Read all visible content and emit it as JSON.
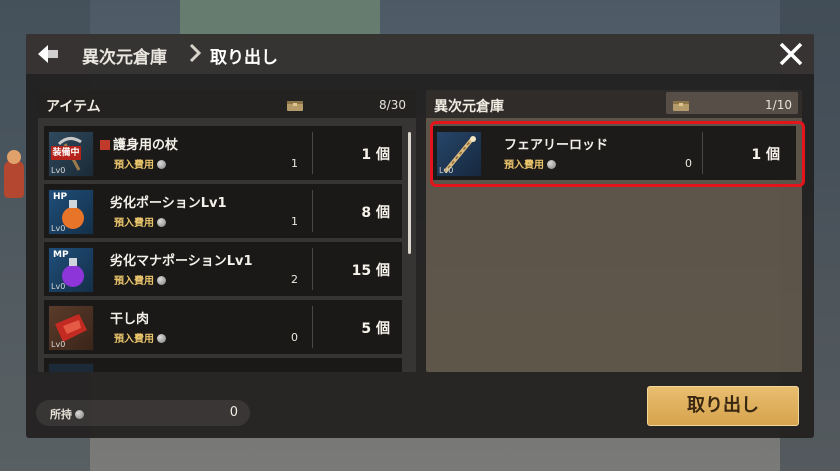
{
  "header": {
    "breadcrumb_root": "異次元倉庫",
    "breadcrumb_current": "取り出し"
  },
  "inventory": {
    "title": "アイテム",
    "count": "8/30",
    "scrollbar_visible": true,
    "items": [
      {
        "name": "護身用の杖",
        "fee_label": "預入費用",
        "fee": "1",
        "qty": "1 個",
        "equipped_badge": "装備中",
        "level": "Lv0",
        "icon": "staff-icon"
      },
      {
        "name": "劣化ポーションLv1",
        "fee_label": "預入費用",
        "fee": "1",
        "qty": "8 個",
        "level": "Lv0",
        "badge": "HP",
        "icon": "hp-potion-icon"
      },
      {
        "name": "劣化マナポーションLv1",
        "fee_label": "預入費用",
        "fee": "2",
        "qty": "15 個",
        "level": "Lv0",
        "badge": "MP",
        "icon": "mp-potion-icon"
      },
      {
        "name": "干し肉",
        "fee_label": "預入費用",
        "fee": "0",
        "qty": "5 個",
        "level": "Lv0",
        "icon": "dried-meat-icon"
      }
    ]
  },
  "storage": {
    "title": "異次元倉庫",
    "count": "1/10",
    "items": [
      {
        "name": "フェアリーロッド",
        "fee_label": "預入費用",
        "fee": "0",
        "qty": "1 個",
        "level": "Lv0",
        "icon": "fairy-rod-icon",
        "selected": true
      }
    ]
  },
  "footer": {
    "owned_label": "所持",
    "owned_value": "0",
    "take_out_button": "取り出し"
  },
  "colors": {
    "accent_button": "#d7a34e",
    "fee_label": "#e8c36a",
    "selection_highlight": "#e3141b",
    "equipped_badge": "#b6231b"
  }
}
